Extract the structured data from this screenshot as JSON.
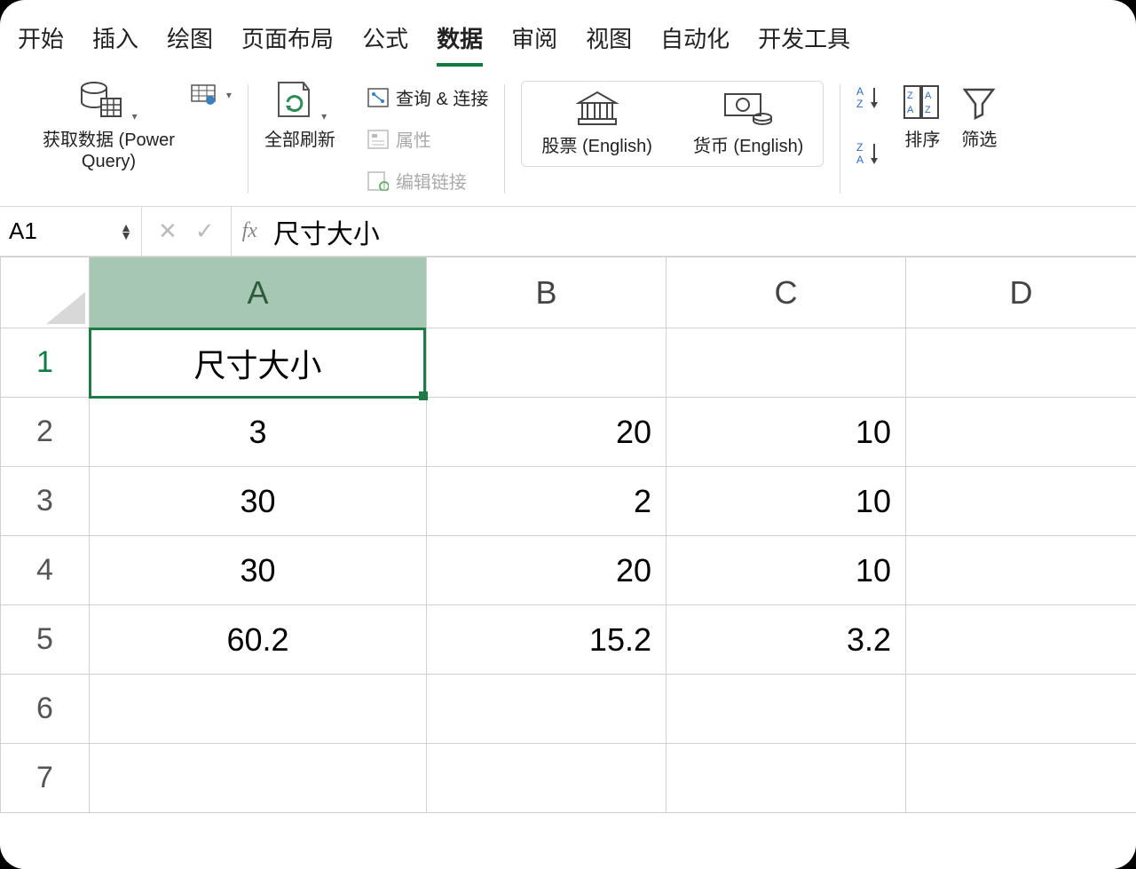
{
  "tabs": {
    "items": [
      "开始",
      "插入",
      "绘图",
      "页面布局",
      "公式",
      "数据",
      "审阅",
      "视图",
      "自动化",
      "开发工具"
    ],
    "active_index": 5
  },
  "ribbon": {
    "get_data": "获取数据 (Power\nQuery)",
    "refresh_all": "全部刷新",
    "queries": "查询 & 连接",
    "properties": "属性",
    "edit_links": "编辑链接",
    "stocks": "股票 (English)",
    "currency": "货币 (English)",
    "sort": "排序",
    "filter": "筛选"
  },
  "formula_bar": {
    "name_box": "A1",
    "fx_label": "fx",
    "content": "尺寸大小"
  },
  "grid": {
    "columns": [
      "A",
      "B",
      "C",
      "D"
    ],
    "row_numbers": [
      1,
      2,
      3,
      4,
      5,
      6,
      7
    ],
    "selected_cell": "A1",
    "cells": {
      "A1": "尺寸大小",
      "A2": "3",
      "B2": "20",
      "C2": "10",
      "A3": "30",
      "B3": "2",
      "C3": "10",
      "A4": "30",
      "B4": "20",
      "C4": "10",
      "A5": "60.2",
      "B5": "15.2",
      "C5": "3.2"
    }
  }
}
